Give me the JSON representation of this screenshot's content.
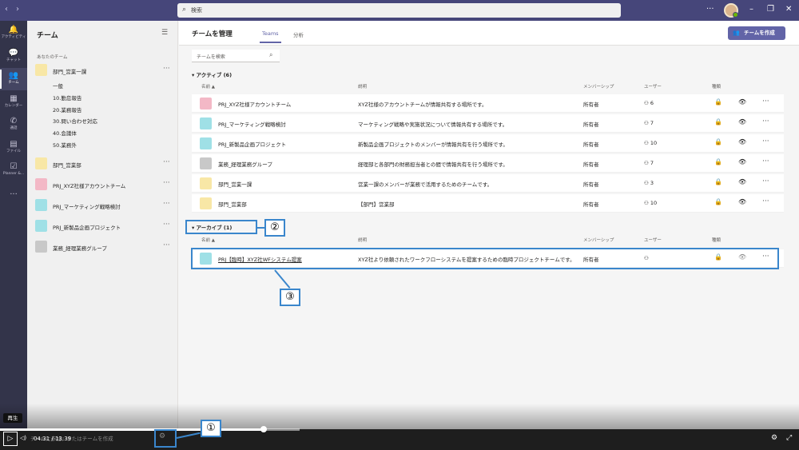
{
  "titlebar": {
    "search_placeholder": "検索",
    "back": "‹",
    "forward": "›",
    "more": "···",
    "minimize": "–",
    "maximize": "❐",
    "close": "✕"
  },
  "rail": [
    {
      "icon": "bell-icon",
      "glyph": "🔔",
      "label": "アクティビティ"
    },
    {
      "icon": "chat-icon",
      "glyph": "💬",
      "label": "チャット"
    },
    {
      "icon": "teams-icon",
      "glyph": "👥",
      "label": "チーム",
      "active": true
    },
    {
      "icon": "calendar-icon",
      "glyph": "▦",
      "label": "カレンダー"
    },
    {
      "icon": "phone-icon",
      "glyph": "✆",
      "label": "通話"
    },
    {
      "icon": "file-icon",
      "glyph": "▤",
      "label": "ファイル"
    },
    {
      "icon": "planner-icon",
      "glyph": "☑",
      "label": "Planner &..."
    },
    {
      "icon": "more-apps-icon",
      "glyph": "···",
      "label": ""
    }
  ],
  "teampanel": {
    "title": "チーム",
    "section": "あなたのチーム",
    "teams": [
      {
        "name": "部門_営業一課",
        "color": "#f8e7a6",
        "channels": [
          "一般",
          "10.勤怠報告",
          "20.業務報告",
          "30.問い合わせ対応",
          "40.会議体",
          "50.業務外"
        ]
      },
      {
        "name": "部門_営業部",
        "color": "#f8e7a6",
        "channels": []
      },
      {
        "name": "PRJ_XYZ社様アカウントチーム",
        "color": "#f3b8c6",
        "channels": []
      },
      {
        "name": "PRJ_マーケティング戦略検討",
        "color": "#9fe0e6",
        "channels": []
      },
      {
        "name": "PRJ_新製品企画プロジェクト",
        "color": "#9fe0e6",
        "channels": []
      },
      {
        "name": "業務_経理業務グループ",
        "color": "#c8c8c8",
        "channels": []
      }
    ],
    "more": "···"
  },
  "header": {
    "title": "チームを管理",
    "tabs": [
      "Teams",
      "分析"
    ],
    "create_button": "チームを作成",
    "create_icon": "👥"
  },
  "team_search": {
    "placeholder": "チームを検索"
  },
  "columns": {
    "name": "名前",
    "sort": "▲",
    "description": "説明",
    "membership": "メンバーシップ",
    "users": "ユーザー",
    "type": "種類"
  },
  "active": {
    "label": "アクティブ (6)",
    "rows": [
      {
        "name": "PRJ_XYZ社様アカウントチーム",
        "desc": "XYZ社様のアカウントチームが情報共有する場所です。",
        "membership": "所有者",
        "users": "6",
        "color": "#f3b8c6"
      },
      {
        "name": "PRJ_マーケティング戦略検討",
        "desc": "マーケティング戦略や実施状況について情報共有する場所です。",
        "membership": "所有者",
        "users": "7",
        "color": "#9fe0e6"
      },
      {
        "name": "PRJ_新製品企画プロジェクト",
        "desc": "新製品企画プロジェクトのメンバーが情報共有を行う場所です。",
        "membership": "所有者",
        "users": "10",
        "color": "#9fe0e6"
      },
      {
        "name": "業務_経理業務グループ",
        "desc": "経理部と各部門の財務担当者との間で情報共有を行う場所です。",
        "membership": "所有者",
        "users": "7",
        "color": "#c8c8c8"
      },
      {
        "name": "部門_営業一課",
        "desc": "営業一課のメンバーが業務で活用するためのチームです。",
        "membership": "所有者",
        "users": "3",
        "color": "#f8e7a6"
      },
      {
        "name": "部門_営業部",
        "desc": "【部門】営業部",
        "membership": "所有者",
        "users": "10",
        "color": "#f8e7a6"
      }
    ]
  },
  "archive": {
    "label": "アーカイブ (1)",
    "rows": [
      {
        "name": "PRJ【臨時】XYZ社WFシステム提案",
        "desc": "XYZ社より依頼されたワークフローシステムを提案するための臨時プロジェクトチームです。",
        "membership": "所有者",
        "users": "",
        "color": "#9fe0e6"
      }
    ]
  },
  "callouts": {
    "c1": "①",
    "c2": "②",
    "c3": "③"
  },
  "video": {
    "time": "04:31 / 13:39",
    "tooltip": "再生",
    "bottom_text": "チームに参加、またはチームを作成",
    "progress": 0.33
  }
}
